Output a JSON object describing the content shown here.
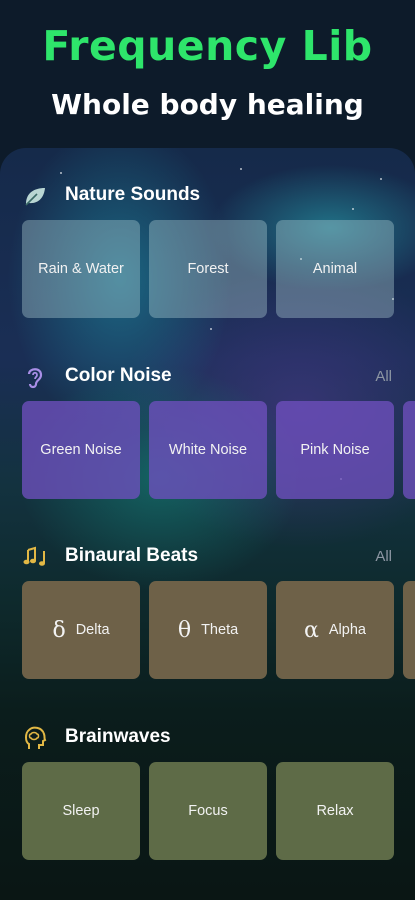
{
  "header": {
    "title": "Frequency Lib",
    "subtitle": "Whole body healing"
  },
  "sections": [
    {
      "title": "Nature Sounds",
      "icon": "leaf-icon",
      "all_label": "",
      "items": [
        {
          "label": "Rain & Water"
        },
        {
          "label": "Forest"
        },
        {
          "label": "Animal"
        }
      ]
    },
    {
      "title": "Color Noise",
      "icon": "ear-icon",
      "all_label": "All",
      "items": [
        {
          "label": "Green Noise"
        },
        {
          "label": "White Noise"
        },
        {
          "label": "Pink Noise"
        }
      ]
    },
    {
      "title": "Binaural Beats",
      "icon": "music-notes-icon",
      "all_label": "All",
      "items": [
        {
          "symbol": "δ",
          "label": "Delta"
        },
        {
          "symbol": "θ",
          "label": "Theta"
        },
        {
          "symbol": "α",
          "label": "Alpha"
        }
      ]
    },
    {
      "title": "Brainwaves",
      "icon": "brain-head-icon",
      "all_label": "",
      "items": [
        {
          "label": "Sleep"
        },
        {
          "label": "Focus"
        },
        {
          "label": "Relax"
        }
      ]
    }
  ],
  "colors": {
    "title_green": "#2ee56b",
    "nature_tile": "#b4d2d7",
    "color_noise_tile": "#6e50be",
    "binaural_tile": "#6e6148",
    "brainwaves_tile": "#5e6b47",
    "icon_accent": "#e2b845"
  }
}
